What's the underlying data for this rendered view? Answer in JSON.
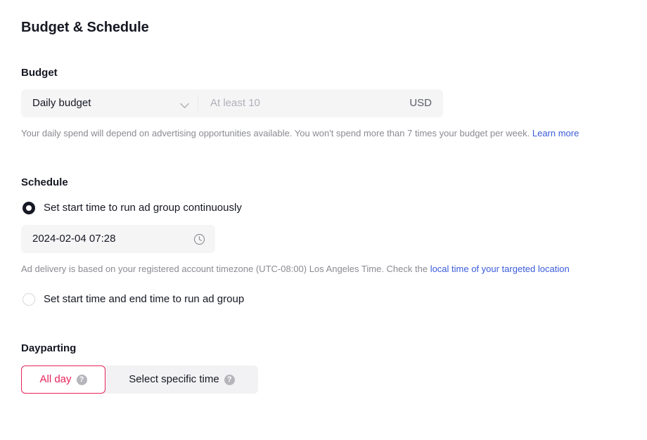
{
  "page": {
    "title": "Budget & Schedule"
  },
  "budget": {
    "section_label": "Budget",
    "type_label": "Daily budget",
    "type_chevron_icon": "chevron-down-icon",
    "amount_value": "",
    "amount_placeholder": "At least 10",
    "currency": "USD",
    "helper_text_1": "Your daily spend will depend on advertising opportunities available. You won't spend more than 7 times your budget per week. ",
    "helper_link": "Learn more"
  },
  "schedule": {
    "section_label": "Schedule",
    "option_continuous": {
      "label": "Set start time to run ad group continuously",
      "selected": true
    },
    "start_time_value": "2024-02-04 07:28",
    "clock_icon": "clock-icon",
    "timezone_text_1": "Ad delivery is based on your registered account timezone (UTC-08:00) Los Angeles Time. Check the ",
    "timezone_link": "local time of your targeted location",
    "option_start_end": {
      "label": "Set start time and end time to run ad group",
      "selected": false
    }
  },
  "dayparting": {
    "section_label": "Dayparting",
    "options": [
      {
        "label": "All day",
        "selected": true,
        "help_icon": "help-circle-icon"
      },
      {
        "label": "Select specific time",
        "selected": false,
        "help_icon": "help-circle-icon"
      }
    ]
  },
  "colors": {
    "accent": "#e8235a",
    "link": "#3a5bdb",
    "text": "#161823",
    "muted": "#8a8b91",
    "field_bg": "#f5f5f6"
  }
}
